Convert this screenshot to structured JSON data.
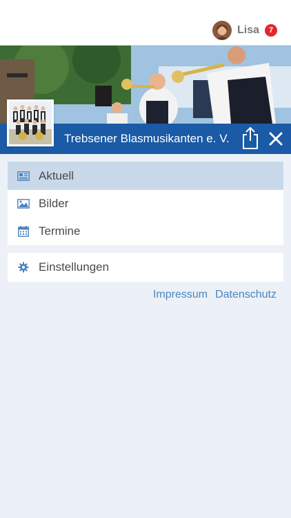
{
  "user": {
    "name": "Lisa",
    "notifications": "7"
  },
  "header": {
    "title": "Trebsener Blasmusikanten e. V."
  },
  "icons": {
    "share": "share-icon",
    "close": "close-icon"
  },
  "menu": {
    "items": [
      {
        "label": "Aktuell",
        "icon": "newspaper-icon",
        "active": true
      },
      {
        "label": "Bilder",
        "icon": "image-icon",
        "active": false
      },
      {
        "label": "Termine",
        "icon": "calendar-icon",
        "active": false
      }
    ],
    "settings": {
      "label": "Einstellungen",
      "icon": "gear-icon"
    }
  },
  "footer": {
    "impressum": "Impressum",
    "datenschutz": "Datenschutz"
  },
  "colors": {
    "banner": "#1a5aa6",
    "active_item": "#c9d9ea",
    "badge": "#e3262d",
    "link": "#4a84bd",
    "background": "#ecf1f8"
  }
}
